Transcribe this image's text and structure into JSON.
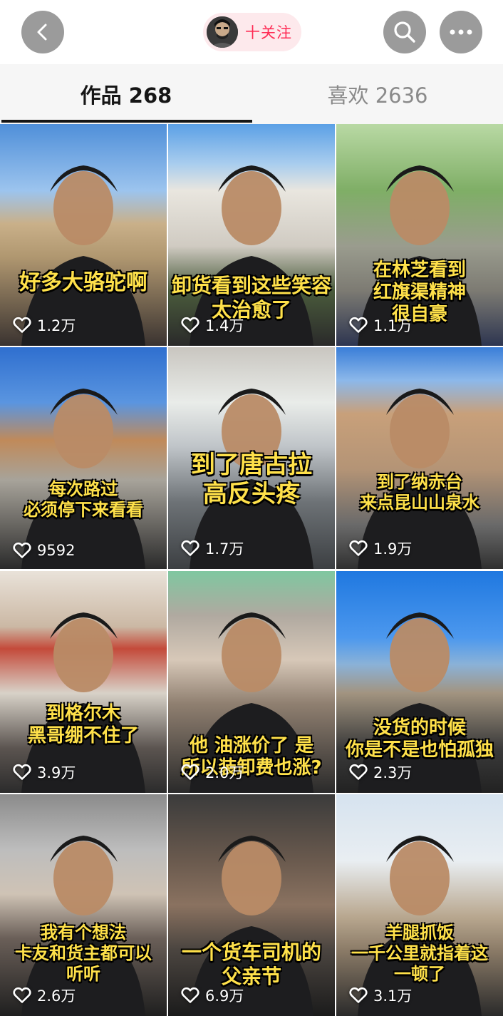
{
  "header": {
    "follow_label": "十关注",
    "icons": {
      "back": "chevron-left-icon",
      "search": "search-icon",
      "more": "more-dots-icon"
    }
  },
  "tabs": [
    {
      "label": "作品 268",
      "active": true
    },
    {
      "label": "喜欢 2636",
      "active": false
    }
  ],
  "videos": [
    {
      "caption": [
        "好多大骆驼啊"
      ],
      "likes": "1.2万",
      "scene": "desert"
    },
    {
      "caption": [
        "卸货看到这些笑容",
        "太治愈了"
      ],
      "likes": "1.4万",
      "scene": "truck"
    },
    {
      "caption": [
        "在林芝看到",
        "红旗渠精神",
        "很自豪"
      ],
      "likes": "1.1万",
      "scene": "trees"
    },
    {
      "caption": [
        "每次路过",
        "必须停下来看看"
      ],
      "likes": "9592",
      "scene": "monument"
    },
    {
      "caption": [
        "到了唐古拉",
        "高反头疼"
      ],
      "likes": "1.7万",
      "scene": "cab"
    },
    {
      "caption": [
        "到了纳赤台",
        "来点昆山山泉水"
      ],
      "likes": "1.9万",
      "scene": "mountain"
    },
    {
      "caption": [
        "到格尔木",
        "黑哥绷不住了"
      ],
      "likes": "3.9万",
      "scene": "shop"
    },
    {
      "caption": [
        "他 油涨价了 是",
        "所以装卸费也涨?"
      ],
      "likes": "2.0万",
      "scene": "cabin-green"
    },
    {
      "caption": [
        "没货的时候",
        "你是不是也怕孤独"
      ],
      "likes": "2.3万",
      "scene": "sky"
    },
    {
      "caption": [
        "我有个想法",
        "卡友和货主都可以",
        "听听"
      ],
      "likes": "2.6万",
      "scene": "sleeper"
    },
    {
      "caption": [
        "一个货车司机的",
        "父亲节"
      ],
      "likes": "6.9万",
      "scene": "dark"
    },
    {
      "caption": [
        "羊腿抓饭",
        "一千公里就指着这",
        "一顿了"
      ],
      "likes": "3.1万",
      "scene": "street"
    }
  ],
  "colors": {
    "accent": "#fe2c55",
    "caption": "#ffe14a",
    "tab_bg": "#f6f6f6"
  }
}
